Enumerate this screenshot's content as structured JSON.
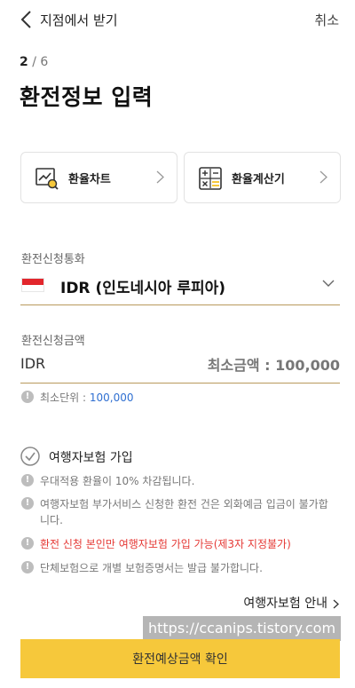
{
  "header": {
    "title": "지점에서 받기",
    "cancel_label": "취소"
  },
  "step": {
    "current": "2",
    "separator": "/",
    "total": "6"
  },
  "page_title": "환전정보 입력",
  "cards": [
    {
      "label": "환율차트",
      "icon": "chart-magnifier-icon"
    },
    {
      "label": "환율계산기",
      "icon": "calculator-icon"
    }
  ],
  "currency": {
    "label": "환전신청통화",
    "value": "IDR (인도네시아 루피아)",
    "flag": "indonesia-flag"
  },
  "amount": {
    "label": "환전신청금액",
    "code": "IDR",
    "placeholder": "최소금액 : 100,000"
  },
  "min_unit": {
    "label": "최소단위 : ",
    "value": "100,000"
  },
  "insurance": {
    "label": "여행자보험 가입"
  },
  "notices": [
    "우대적용 환율이 10% 차감됩니다.",
    "여행자보험 부가서비스 신청한 환전 건은 외화예금 입금이 불가합니다.",
    "환전 신청 본인만 여행자보험 가입 가능(제3자 지정불가)",
    "단체보험으로 개별 보험증명서는 발급 불가합니다."
  ],
  "guide_link": "여행자보험 안내",
  "watermark": "https://ccanips.tistory.com",
  "confirm_label": "환전예상금액 확인",
  "colors": {
    "accent": "#f6c83b",
    "underline": "#b99a5c",
    "warning": "#e53935",
    "link": "#2f6fd1"
  }
}
